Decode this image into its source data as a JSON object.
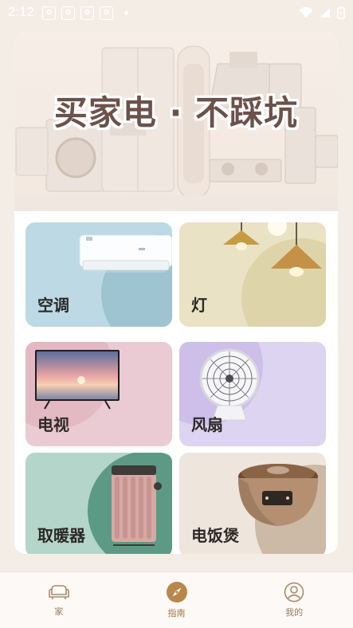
{
  "status_bar": {
    "time": "2:12"
  },
  "banner": {
    "title": "买家电 · 不踩坑"
  },
  "categories": [
    {
      "label": "空调"
    },
    {
      "label": "灯"
    },
    {
      "label": "电视"
    },
    {
      "label": "风扇"
    },
    {
      "label": "取暖器"
    },
    {
      "label": "电饭煲"
    }
  ],
  "nav": {
    "items": [
      {
        "label": "家",
        "icon": "sofa-icon"
      },
      {
        "label": "指南",
        "icon": "compass-icon"
      },
      {
        "label": "我的",
        "icon": "profile-icon"
      }
    ],
    "active": "指南"
  },
  "colors": {
    "background": "#f4ede6",
    "accent": "#b8864a",
    "title": "#6b524a"
  }
}
